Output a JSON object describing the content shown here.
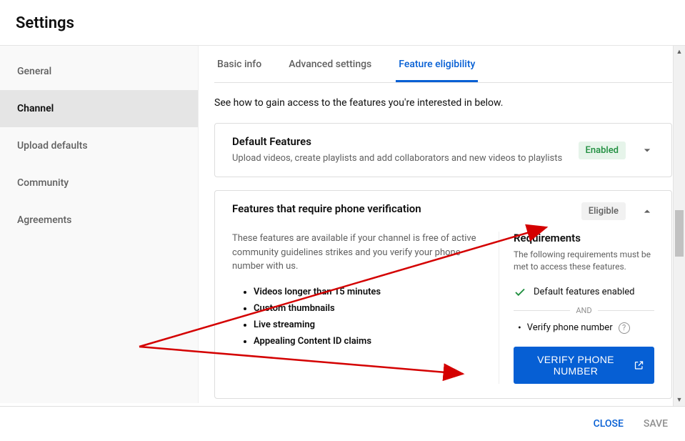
{
  "header": {
    "title": "Settings"
  },
  "sidebar": {
    "items": [
      {
        "label": "General"
      },
      {
        "label": "Channel"
      },
      {
        "label": "Upload defaults"
      },
      {
        "label": "Community"
      },
      {
        "label": "Agreements"
      }
    ],
    "active_index": 1
  },
  "tabs": {
    "items": [
      {
        "label": "Basic info"
      },
      {
        "label": "Advanced settings"
      },
      {
        "label": "Feature eligibility"
      }
    ],
    "active_index": 2
  },
  "intro": "See how to gain access to the features you're interested in below.",
  "card_default": {
    "title": "Default Features",
    "sub": "Upload videos, create playlists and add collaborators and new videos to playlists",
    "status": "Enabled"
  },
  "card_phone": {
    "title": "Features that require phone verification",
    "status": "Eligible",
    "desc": "These features are available if your channel is free of active community guidelines strikes and you verify your phone number with us.",
    "features": [
      "Videos longer than 15 minutes",
      "Custom thumbnails",
      "Live streaming",
      "Appealing Content ID claims"
    ],
    "req_title": "Requirements",
    "req_sub": "The following requirements must be met to access these features.",
    "req_done": "Default features enabled",
    "and": "AND",
    "req_pending": "Verify phone number",
    "verify_label": "VERIFY PHONE NUMBER"
  },
  "footer": {
    "close": "CLOSE",
    "save": "SAVE"
  }
}
